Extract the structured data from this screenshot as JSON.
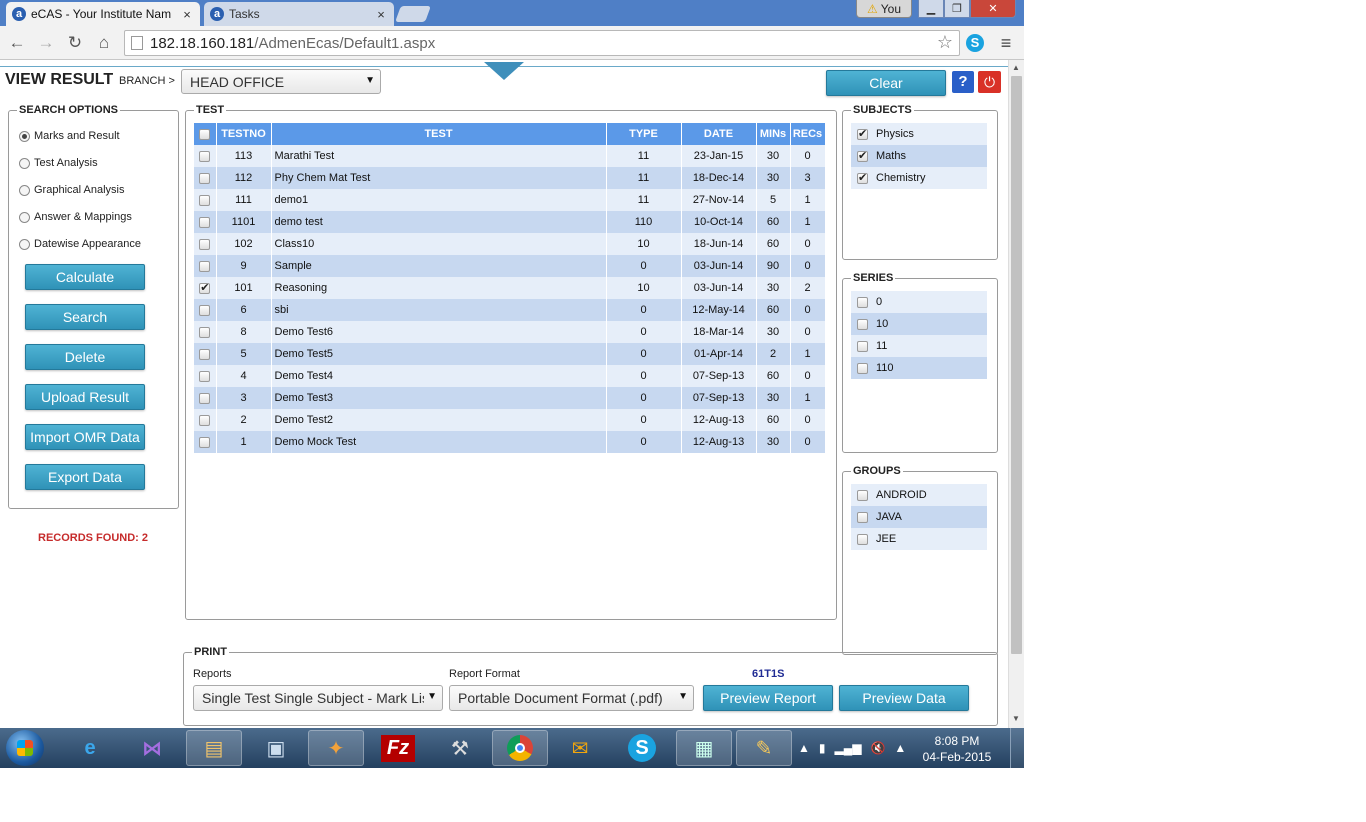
{
  "browser": {
    "tabs": [
      {
        "title": "eCAS - Your Institute Nam",
        "favicon": "a"
      },
      {
        "title": "Tasks",
        "favicon": "a"
      }
    ],
    "user_badge": "You",
    "url_host": "182.18.160.181",
    "url_path": "/AdmenEcas/Default1.aspx",
    "window_controls": [
      "minimize-icon",
      "restore-icon",
      "close-icon"
    ]
  },
  "header": {
    "title": "VIEW RESULT",
    "branch_label": "BRANCH >",
    "branch_value": "HEAD OFFICE",
    "clear_label": "Clear",
    "help_label": "?"
  },
  "search_options": {
    "legend": "SEARCH OPTIONS",
    "radios": [
      {
        "label": "Marks and Result",
        "selected": true
      },
      {
        "label": "Test Analysis",
        "selected": false
      },
      {
        "label": "Graphical Analysis",
        "selected": false
      },
      {
        "label": "Answer & Mappings",
        "selected": false
      },
      {
        "label": "Datewise Appearance",
        "selected": false
      }
    ],
    "buttons": [
      "Calculate",
      "Search",
      "Delete",
      "Upload Result",
      "Import OMR Data",
      "Export Data"
    ],
    "records_found": "RECORDS FOUND: 2"
  },
  "test": {
    "legend": "TEST",
    "columns": [
      "TESTNO",
      "TEST",
      "TYPE",
      "DATE",
      "MINs",
      "RECs"
    ],
    "rows": [
      {
        "checked": false,
        "testno": "113",
        "test": "Marathi Test",
        "type": "11",
        "date": "23-Jan-15",
        "mins": "30",
        "recs": "0"
      },
      {
        "checked": false,
        "testno": "112",
        "test": "Phy Chem Mat Test",
        "type": "11",
        "date": "18-Dec-14",
        "mins": "30",
        "recs": "3"
      },
      {
        "checked": false,
        "testno": "111",
        "test": "demo1",
        "type": "11",
        "date": "27-Nov-14",
        "mins": "5",
        "recs": "1"
      },
      {
        "checked": false,
        "testno": "1101",
        "test": "demo test",
        "type": "110",
        "date": "10-Oct-14",
        "mins": "60",
        "recs": "1"
      },
      {
        "checked": false,
        "testno": "102",
        "test": "Class10",
        "type": "10",
        "date": "18-Jun-14",
        "mins": "60",
        "recs": "0"
      },
      {
        "checked": false,
        "testno": "9",
        "test": "Sample",
        "type": "0",
        "date": "03-Jun-14",
        "mins": "90",
        "recs": "0"
      },
      {
        "checked": true,
        "testno": "101",
        "test": "Reasoning",
        "type": "10",
        "date": "03-Jun-14",
        "mins": "30",
        "recs": "2"
      },
      {
        "checked": false,
        "testno": "6",
        "test": "sbi",
        "type": "0",
        "date": "12-May-14",
        "mins": "60",
        "recs": "0"
      },
      {
        "checked": false,
        "testno": "8",
        "test": "Demo Test6",
        "type": "0",
        "date": "18-Mar-14",
        "mins": "30",
        "recs": "0"
      },
      {
        "checked": false,
        "testno": "5",
        "test": "Demo Test5",
        "type": "0",
        "date": "01-Apr-14",
        "mins": "2",
        "recs": "1"
      },
      {
        "checked": false,
        "testno": "4",
        "test": "Demo Test4",
        "type": "0",
        "date": "07-Sep-13",
        "mins": "60",
        "recs": "0"
      },
      {
        "checked": false,
        "testno": "3",
        "test": "Demo Test3",
        "type": "0",
        "date": "07-Sep-13",
        "mins": "30",
        "recs": "1"
      },
      {
        "checked": false,
        "testno": "2",
        "test": "Demo Test2",
        "type": "0",
        "date": "12-Aug-13",
        "mins": "60",
        "recs": "0"
      },
      {
        "checked": false,
        "testno": "1",
        "test": "Demo Mock Test",
        "type": "0",
        "date": "12-Aug-13",
        "mins": "30",
        "recs": "0"
      }
    ]
  },
  "subjects": {
    "legend": "SUBJECTS",
    "items": [
      {
        "label": "Physics",
        "checked": true
      },
      {
        "label": "Maths",
        "checked": true
      },
      {
        "label": "Chemistry",
        "checked": true
      }
    ]
  },
  "series": {
    "legend": "SERIES",
    "items": [
      {
        "label": "0",
        "checked": false
      },
      {
        "label": "10",
        "checked": false
      },
      {
        "label": "11",
        "checked": false
      },
      {
        "label": "110",
        "checked": false
      }
    ]
  },
  "groups": {
    "legend": "GROUPS",
    "items": [
      {
        "label": "ANDROID",
        "checked": false
      },
      {
        "label": "JAVA",
        "checked": false
      },
      {
        "label": "JEE",
        "checked": false
      }
    ]
  },
  "print": {
    "legend": "PRINT",
    "reports_label": "Reports",
    "reports_value": "Single Test Single Subject - Mark List",
    "format_label": "Report Format",
    "format_value": "Portable Document Format (.pdf)",
    "code": "61T1S",
    "preview_report_label": "Preview Report",
    "preview_data_label": "Preview Data"
  },
  "taskbar": {
    "apps": [
      "windows-start-icon",
      "internet-explorer-icon",
      "visual-studio-icon",
      "file-explorer-icon",
      "remote-desktop-icon",
      "office-tools-icon",
      "filezilla-icon",
      "build-tools-icon",
      "chrome-icon",
      "outlook-icon",
      "skype-icon",
      "control-panel-icon",
      "paint-icon"
    ],
    "time": "8:08 PM",
    "date": "04-Feb-2015"
  },
  "colors": {
    "accent_button": "#2f92b7",
    "table_header": "#5b99e8",
    "row_light": "#e6eef9",
    "row_dark": "#c7d8f0",
    "records_found": "#c62b2b",
    "code_text": "#1f2b94"
  }
}
